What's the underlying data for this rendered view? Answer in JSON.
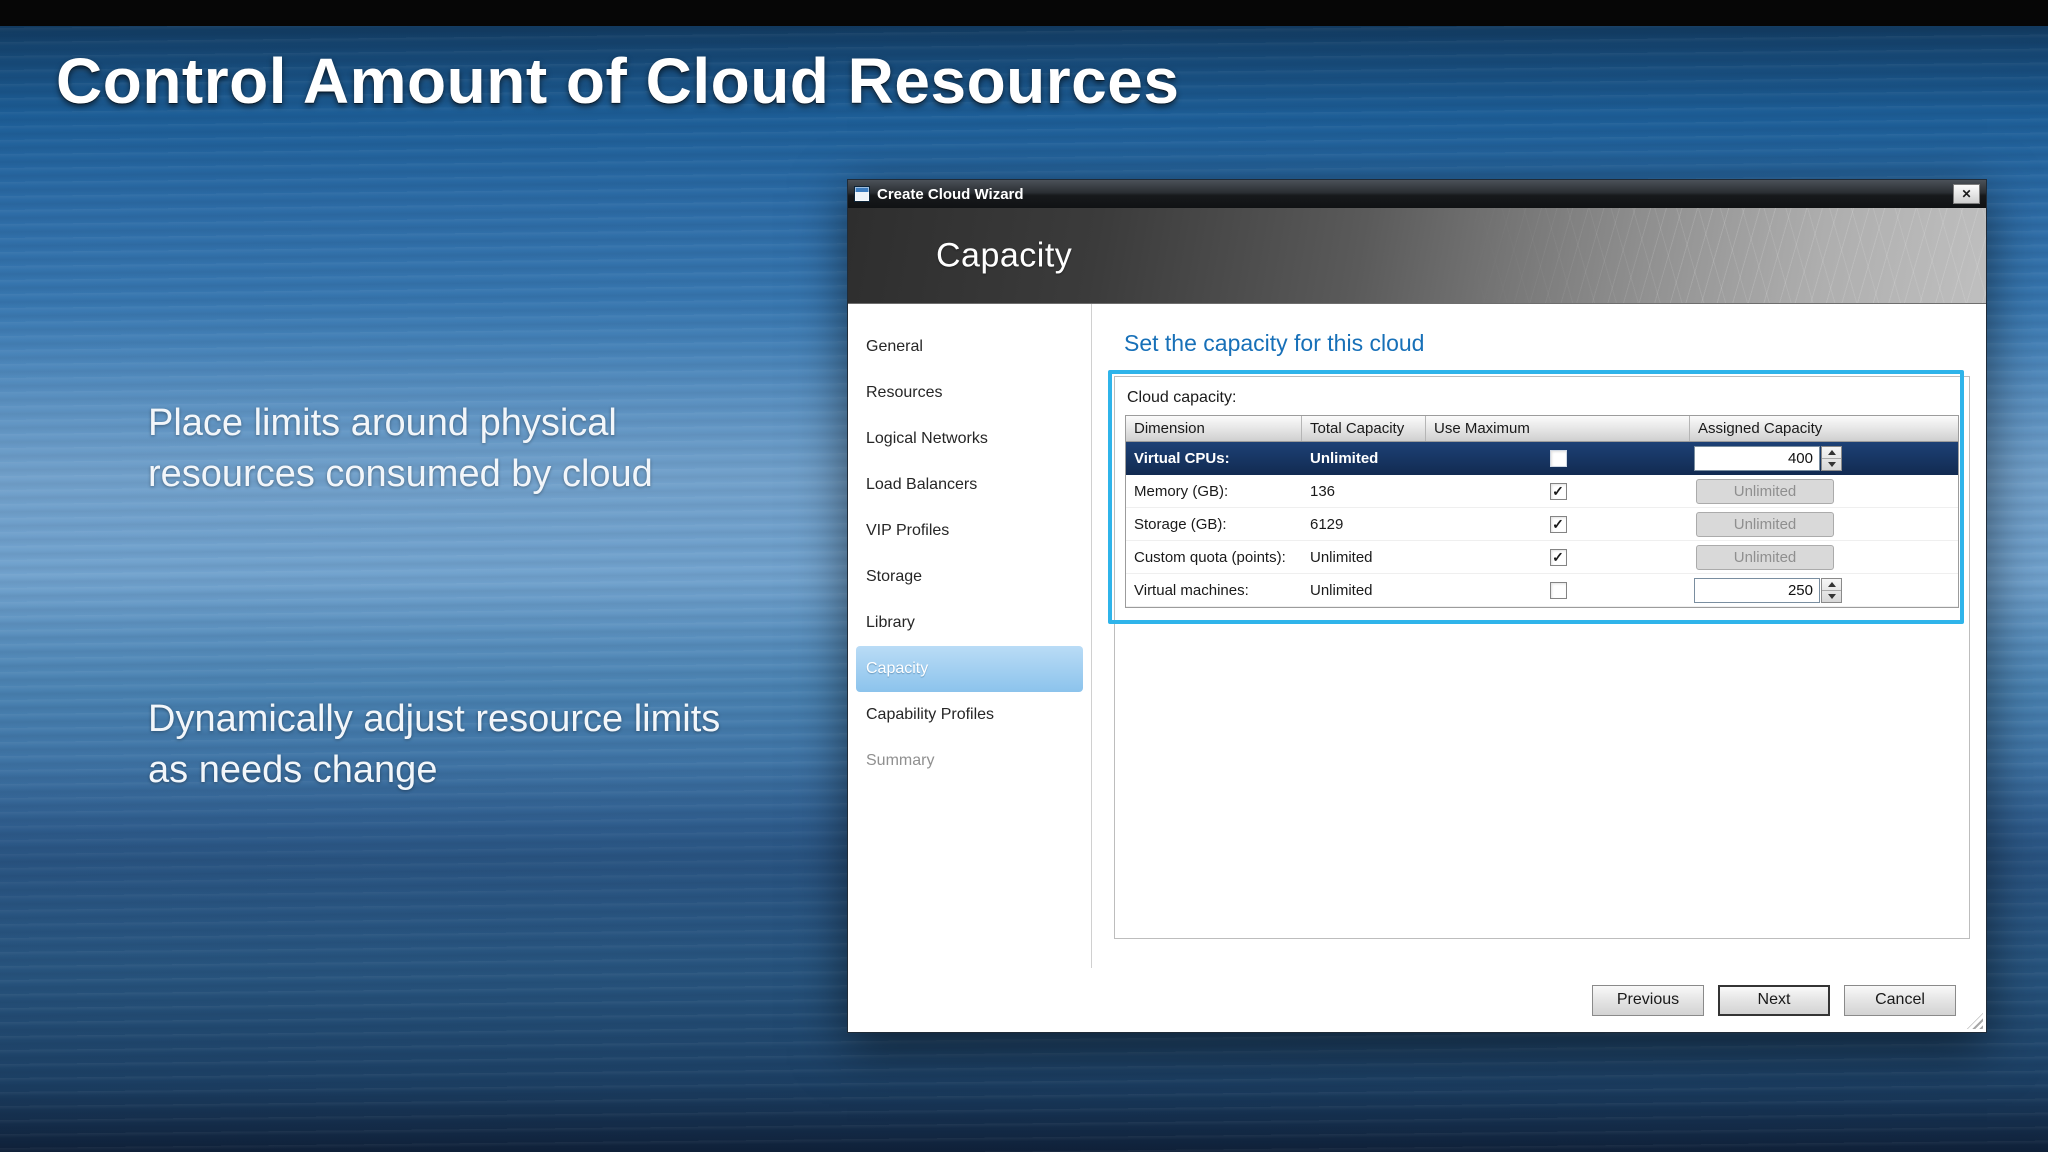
{
  "slide": {
    "top_title": "Control Amount of Cloud Resources",
    "bullets": [
      "Place limits around physical resources consumed by cloud",
      "Dynamically adjust resource limits as needs change"
    ]
  },
  "wizard": {
    "window_title": "Create Cloud Wizard",
    "close_label": "✕",
    "banner_title": "Capacity",
    "nav_items": [
      {
        "label": "General",
        "state": "normal"
      },
      {
        "label": "Resources",
        "state": "normal"
      },
      {
        "label": "Logical Networks",
        "state": "normal"
      },
      {
        "label": "Load Balancers",
        "state": "normal"
      },
      {
        "label": "VIP Profiles",
        "state": "normal"
      },
      {
        "label": "Storage",
        "state": "normal"
      },
      {
        "label": "Library",
        "state": "normal"
      },
      {
        "label": "Capacity",
        "state": "active"
      },
      {
        "label": "Capability Profiles",
        "state": "normal"
      },
      {
        "label": "Summary",
        "state": "disabled"
      }
    ],
    "content": {
      "heading": "Set the capacity for this cloud",
      "group_label": "Cloud capacity:",
      "table": {
        "columns": [
          "Dimension",
          "Total Capacity",
          "Use Maximum",
          "Assigned Capacity"
        ],
        "rows": [
          {
            "dimension": "Virtual CPUs:",
            "total_capacity": "Unlimited",
            "use_maximum": false,
            "assigned_capacity": "400",
            "assigned_control": "spinner",
            "selected": true
          },
          {
            "dimension": "Memory (GB):",
            "total_capacity": "136",
            "use_maximum": true,
            "assigned_capacity": "Unlimited",
            "assigned_control": "disabled",
            "selected": false
          },
          {
            "dimension": "Storage (GB):",
            "total_capacity": "6129",
            "use_maximum": true,
            "assigned_capacity": "Unlimited",
            "assigned_control": "disabled",
            "selected": false
          },
          {
            "dimension": "Custom quota (points):",
            "total_capacity": "Unlimited",
            "use_maximum": true,
            "assigned_capacity": "Unlimited",
            "assigned_control": "disabled",
            "selected": false
          },
          {
            "dimension": "Virtual machines:",
            "total_capacity": "Unlimited",
            "use_maximum": false,
            "assigned_capacity": "250",
            "assigned_control": "spinner",
            "selected": false
          }
        ]
      }
    },
    "footer_buttons": [
      {
        "label": "Previous",
        "default": false
      },
      {
        "label": "Next",
        "default": true
      },
      {
        "label": "Cancel",
        "default": false
      }
    ],
    "annotation_color": "#2fb4ea"
  }
}
